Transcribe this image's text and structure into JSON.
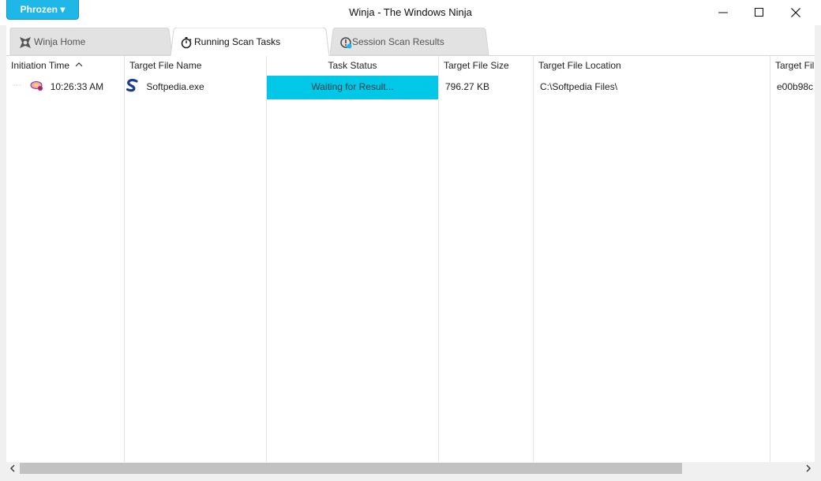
{
  "app": {
    "brand_label": "Phrozen ▾",
    "window_title": "Winja - The Windows Ninja"
  },
  "tabs": [
    {
      "label": "Winja Home",
      "icon": "ninja-icon"
    },
    {
      "label": "Running Scan Tasks",
      "icon": "stopwatch-icon"
    },
    {
      "label": "Session Scan Results",
      "icon": "info-icon"
    }
  ],
  "active_tab": "Running Scan Tasks",
  "table": {
    "columns": [
      "Initiation Time",
      "Target File Name",
      "Task Status",
      "Target File Size",
      "Target File Location",
      "Target Fil"
    ],
    "sorted_column": "Initiation Time",
    "sort_direction": "ascending",
    "rows": [
      {
        "initiation_time": "10:26:33 AM",
        "file_name": "Softpedia.exe",
        "task_status": "Waiting for Result...",
        "file_size": "796.27 KB",
        "file_location": "C:\\Softpedia Files\\",
        "hash_partial": "e00b98c"
      }
    ]
  },
  "colors": {
    "accent": "#1fb6e8",
    "status_bg": "#00c8e6"
  }
}
